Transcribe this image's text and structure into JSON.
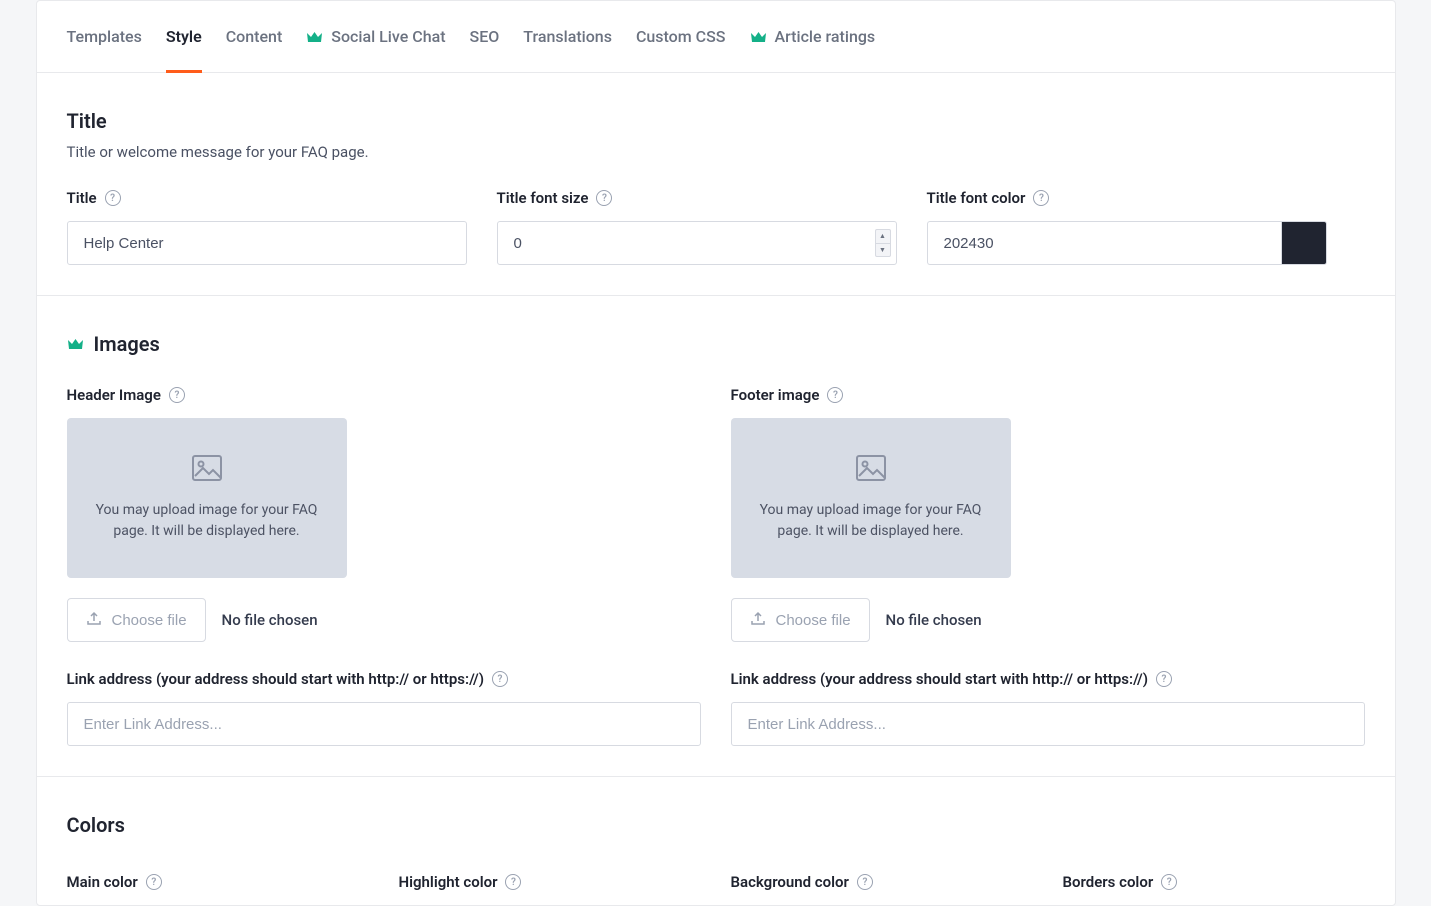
{
  "tabs": {
    "templates": "Templates",
    "style": "Style",
    "content": "Content",
    "social": "Social Live Chat",
    "seo": "SEO",
    "translations": "Translations",
    "custom_css": "Custom CSS",
    "article_ratings": "Article ratings"
  },
  "title_section": {
    "heading": "Title",
    "description": "Title or welcome message for your FAQ page.",
    "title_label": "Title",
    "title_value": "Help Center",
    "font_size_label": "Title font size",
    "font_size_value": "0",
    "font_color_label": "Title font color",
    "font_color_value": "202430",
    "font_color_hex": "#202430"
  },
  "images_section": {
    "heading": "Images",
    "header_label": "Header Image",
    "footer_label": "Footer image",
    "placeholder_text": "You may upload image for your FAQ page. It will be displayed here.",
    "choose_file": "Choose file",
    "no_file": "No file chosen",
    "link_label": "Link address (your address should start with http:// or https://)",
    "link_placeholder": "Enter Link Address..."
  },
  "colors_section": {
    "heading": "Colors",
    "main_label": "Main color",
    "highlight_label": "Highlight color",
    "background_label": "Background color",
    "borders_label": "Borders color"
  }
}
